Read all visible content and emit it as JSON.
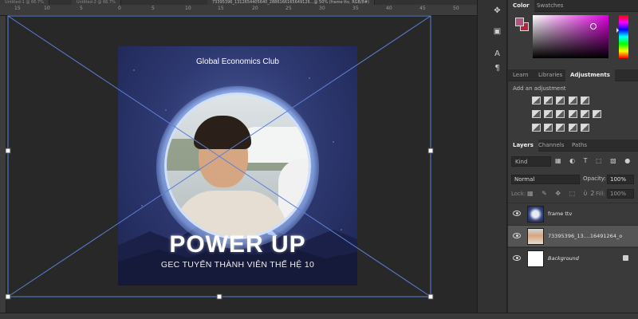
{
  "document_tabs": [
    "Untitled-1 @ 66.7%",
    "Untitled-2 @ 66.7%",
    "73395396_1312654405640_2886166165649126...@ 50% (frame ttv, RGB/8#)"
  ],
  "ruler_labels": [
    "15",
    "10",
    "5",
    "0",
    "5",
    "10",
    "15",
    "20",
    "25",
    "30",
    "35",
    "40",
    "45",
    "50"
  ],
  "artwork": {
    "club_name": "Global Economics Club",
    "headline": "POWER UP",
    "subtitle": "GEC TUYỂN THÀNH VIÊN THẾ HỆ 10"
  },
  "tools": [
    "move-icon",
    "transform-icon",
    "text-icon",
    "paragraph-icon"
  ],
  "tool_glyphs": [
    "✥",
    "▣",
    "A",
    "¶"
  ],
  "color_panel": {
    "tabs": [
      "Color",
      "Swatches"
    ],
    "foreground": "#b2507f",
    "background": "#c01f3c"
  },
  "adjustments_panel": {
    "tabs": [
      "Learn",
      "Libraries",
      "Adjustments"
    ],
    "hint": "Add an adjustment"
  },
  "layers_panel": {
    "tabs": [
      "Layers",
      "Channels",
      "Paths"
    ],
    "kind": "Kind",
    "kind_icons": "▦ ◐ T ⬚ ▧ ●",
    "blend_mode": "Normal",
    "opacity_label": "Opacity:",
    "opacity": "100%",
    "lock_label": "Lock:",
    "lock_icons": "▦ ✎ ✥ ⬚ ὑ2",
    "fill_label": "Fill:",
    "fill": "100%",
    "layers": [
      {
        "name": "frame ttv",
        "selected": false
      },
      {
        "name": "73395396_13....16491264_o",
        "selected": true
      },
      {
        "name": "Background",
        "selected": false
      }
    ]
  }
}
